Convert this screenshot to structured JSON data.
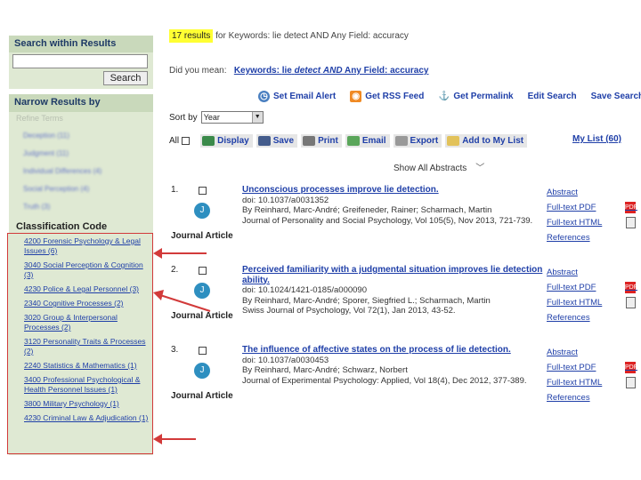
{
  "sidebar": {
    "search_within": {
      "heading": "Search within Results",
      "input_value": "",
      "button_label": "Search"
    },
    "narrow": {
      "heading": "Narrow Results by",
      "subheading": "Refine Terms",
      "blurred_items": [
        "Deception (11)",
        "Judgment (11)",
        "Individual Differences (4)",
        "Social Perception (4)",
        "Truth (3)"
      ],
      "classification_heading": "Classification Code",
      "classification_items": [
        "4200 Forensic Psychology & Legal Issues (6)",
        "3040 Social Perception & Cognition (3)",
        "4230 Police & Legal Personnel (3)",
        "2340 Cognitive Processes (2)",
        "3020 Group & Interpersonal Processes (2)",
        "3120 Personality Traits & Processes (2)",
        "2240 Statistics & Mathematics (1)",
        "3400 Professional Psychological & Health Personnel Issues (1)",
        "3800 Military Psychology (1)",
        "4230 Criminal Law & Adjudication (1)"
      ]
    }
  },
  "main": {
    "results_count": "17 results",
    "results_query": "for Keywords: lie detect AND Any Field: accuracy",
    "did_you_mean_label": "Did you mean:",
    "did_you_mean_keywords": "Keywords:",
    "did_you_mean_lie": "lie",
    "did_you_mean_detect": "detect",
    "did_you_mean_and": "AND",
    "did_you_mean_field": "Any Field:",
    "did_you_mean_accuracy": "accuracy",
    "top_toolbar": {
      "email_alert": "Set Email Alert",
      "rss": "Get RSS Feed",
      "permalink": "Get Permalink",
      "edit": "Edit Search",
      "save": "Save Search"
    },
    "sort_label": "Sort by",
    "sort_value": "Year",
    "actions_toolbar": {
      "all_label": "All",
      "display": "Display",
      "save": "Save",
      "print": "Print",
      "email": "Email",
      "export": "Export",
      "add_to_list": "Add to My List",
      "my_list": "My List (60)"
    },
    "show_abstracts": "Show All Abstracts",
    "results": [
      {
        "num": "1.",
        "title": "Unconscious processes improve lie detection.",
        "doi": "doi: 10.1037/a0031352",
        "authors": "By Reinhard, Marc-André; Greifeneder, Rainer; Scharmach, Martin",
        "source": "Journal of Personality and Social Psychology, Vol 105(5), Nov 2013, 721-739.",
        "type": "Journal Article",
        "links": [
          "Abstract",
          "Full-text PDF",
          "Full-text HTML",
          "References"
        ]
      },
      {
        "num": "2.",
        "title": "Perceived familiarity with a judgmental situation improves lie detection ability.",
        "doi": "doi: 10.1024/1421-0185/a000090",
        "authors": "By Reinhard, Marc-André; Sporer, Siegfried L.; Scharmach, Martin",
        "source": "Swiss Journal of Psychology, Vol 72(1), Jan 2013, 43-52.",
        "type": "Journal Article",
        "links": [
          "Abstract",
          "Full-text PDF",
          "Full-text HTML",
          "References"
        ]
      },
      {
        "num": "3.",
        "title": "The influence of affective states on the process of lie detection.",
        "doi": "doi: 10.1037/a0030453",
        "authors": "By Reinhard, Marc-André; Schwarz, Norbert",
        "source": "Journal of Experimental Psychology: Applied, Vol 18(4), Dec 2012, 377-389.",
        "type": "Journal Article",
        "links": [
          "Abstract",
          "Full-text PDF",
          "Full-text HTML",
          "References"
        ]
      }
    ]
  },
  "colors": {
    "panel_bg": "#dfe9d3",
    "panel_header": "#c9d9bb",
    "link": "#1f3fa8",
    "highlight": "#ffff33",
    "annotation_red": "#d23a3a"
  }
}
